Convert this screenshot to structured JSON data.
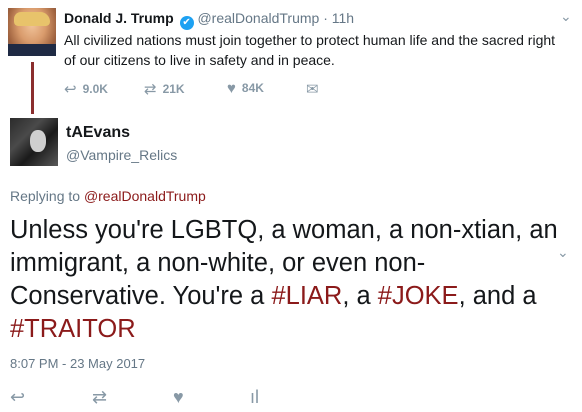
{
  "tweet1": {
    "name": "Donald J. Trump",
    "verified_badge": "✔",
    "handle": "@realDonaldTrump",
    "time": "· 11h",
    "text": "All civilized nations must join together to protect human life and the sacred right of our citizens to live in safety and in peace.",
    "replies": "9.0K",
    "retweets": "21K",
    "likes": "84K"
  },
  "tweet2": {
    "name": "tAEvans",
    "handle": "@Vampire_Relics",
    "replying_prefix": "Replying to",
    "replying_to": "@realDonaldTrump",
    "text_before": "Unless you're LGBTQ, a woman, a non-xtian, an immigrant, a non-white, or even non-Conservative.  You're a ",
    "hashtag1": "#LIAR",
    "text_mid1": ", a ",
    "hashtag2": "#JOKE",
    "text_mid2": ", and a ",
    "hashtag3": "#TRAITOR",
    "date": "8:07 PM - 23 May 2017"
  },
  "icons": {
    "reply": "↩",
    "retweet": "⇄",
    "like": "♥",
    "dm": "✉",
    "caret": "⌄",
    "analytics": "ıl"
  },
  "colors": {
    "accent": "#8b1a1a",
    "thread_line": "#8b2e2e",
    "muted": "#657786",
    "icon": "#8899a6"
  }
}
